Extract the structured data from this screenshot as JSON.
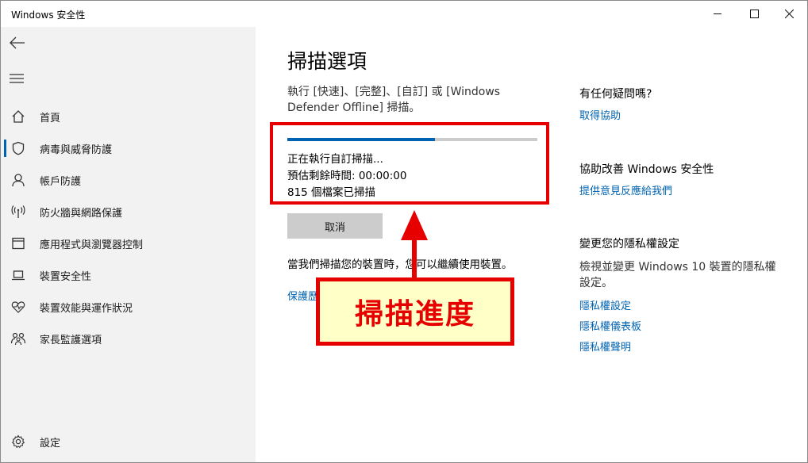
{
  "window": {
    "title": "Windows 安全性"
  },
  "sidebar": {
    "items": [
      {
        "label": "首頁",
        "icon": "home-icon"
      },
      {
        "label": "病毒與威脅防護",
        "icon": "shield-icon"
      },
      {
        "label": "帳戶防護",
        "icon": "person-icon"
      },
      {
        "label": "防火牆與網路保護",
        "icon": "wireless-icon"
      },
      {
        "label": "應用程式與瀏覽器控制",
        "icon": "app-window-icon"
      },
      {
        "label": "裝置安全性",
        "icon": "laptop-icon"
      },
      {
        "label": "裝置效能與運作狀況",
        "icon": "heart-pulse-icon"
      },
      {
        "label": "家長監護選項",
        "icon": "family-icon"
      }
    ],
    "active_index": 1,
    "settings_label": "設定"
  },
  "main": {
    "title": "掃描選項",
    "description": "執行 [快速]、[完整]、[自訂] 或 [Windows Defender Offline] 掃描。",
    "progress": {
      "fraction": 0.59
    },
    "status_lines": [
      "正在執行自訂掃描...",
      "預估剩餘時間: 00:00:00",
      "815 個檔案已掃描"
    ],
    "cancel_label": "取消",
    "note": "當我們掃描您的裝置時，您可以繼續使用裝置。",
    "partial_link": "保護歷"
  },
  "right": {
    "help_heading": "有任何疑問嗎?",
    "help_link": "取得協助",
    "improve_heading": "協助改善 Windows 安全性",
    "improve_link": "提供意見反應給我們",
    "privacy_heading": "變更您的隱私權設定",
    "privacy_text": "檢視並變更 Windows 10 裝置的隱私權設定。",
    "privacy_links": [
      "隱私權設定",
      "隱私權儀表板",
      "隱私權聲明"
    ]
  },
  "annotation": {
    "callout_label": "掃描進度",
    "color": "#e60000"
  },
  "colors": {
    "accent": "#0063b1",
    "sidebar_bg": "#f2f2f2"
  }
}
